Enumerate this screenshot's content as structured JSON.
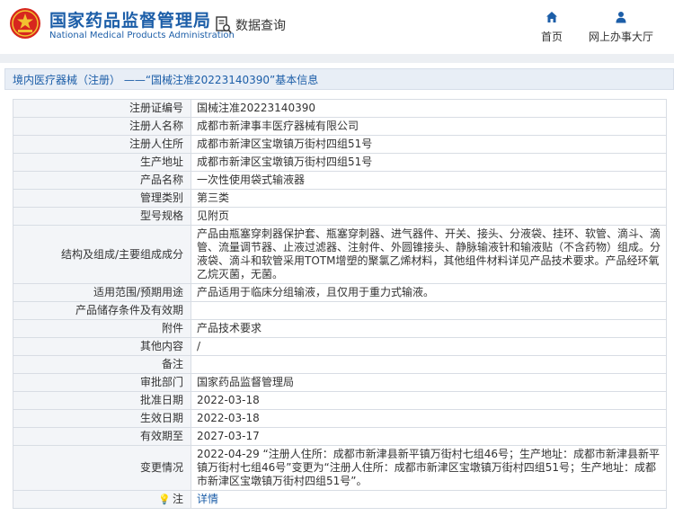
{
  "header": {
    "brand_cn": "国家药品监督管理局",
    "brand_en": "National Medical Products Administration",
    "data_query": "数据查询",
    "nav_home": "首页",
    "nav_online": "网上办事大厅"
  },
  "breadcrumb": "境内医疗器械（注册） ——“国械注准20223140390”基本信息",
  "rows": [
    {
      "label": "注册证编号",
      "value": "国械注准20223140390"
    },
    {
      "label": "注册人名称",
      "value": "成都市新津事丰医疗器械有限公司"
    },
    {
      "label": "注册人住所",
      "value": "成都市新津区宝墩镇万街村四组51号"
    },
    {
      "label": "生产地址",
      "value": "成都市新津区宝墩镇万街村四组51号"
    },
    {
      "label": "产品名称",
      "value": "一次性使用袋式输液器"
    },
    {
      "label": "管理类别",
      "value": "第三类"
    },
    {
      "label": "型号规格",
      "value": "见附页"
    },
    {
      "label": "结构及组成/主要组成成分",
      "value": "产品由瓶塞穿刺器保护套、瓶塞穿刺器、进气器件、开关、接头、分液袋、挂环、软管、滴斗、滴管、流量调节器、止液过滤器、注射件、外圆锥接头、静脉输液针和输液贴（不含药物）组成。分液袋、滴斗和软管采用TOTM增塑的聚氯乙烯材料，其他组件材料详见产品技术要求。产品经环氧乙烷灭菌，无菌。"
    },
    {
      "label": "适用范围/预期用途",
      "value": "产品适用于临床分组输液，且仅用于重力式输液。"
    },
    {
      "label": "产品储存条件及有效期",
      "value": ""
    },
    {
      "label": "附件",
      "value": "产品技术要求"
    },
    {
      "label": "其他内容",
      "value": "/"
    },
    {
      "label": "备注",
      "value": ""
    },
    {
      "label": "审批部门",
      "value": "国家药品监督管理局"
    },
    {
      "label": "批准日期",
      "value": "2022-03-18"
    },
    {
      "label": "生效日期",
      "value": "2022-03-18"
    },
    {
      "label": "有效期至",
      "value": "2027-03-17"
    },
    {
      "label": "变更情况",
      "value": "2022-04-29 “注册人住所：成都市新津县新平镇万街村七组46号；生产地址：成都市新津县新平镇万街村七组46号”变更为“注册人住所：成都市新津区宝墩镇万街村四组51号；生产地址：成都市新津区宝墩镇万街村四组51号”。"
    }
  ],
  "note": {
    "label": "注",
    "value": "详情"
  },
  "colors": {
    "brand": "#1c5ea8",
    "logo_red": "#d7261e",
    "logo_gold": "#f2c230"
  },
  "icons": {
    "logo": "emblem-icon",
    "search": "document-search-icon",
    "home": "home-icon",
    "user": "user-icon",
    "note": "lightbulb-icon"
  }
}
